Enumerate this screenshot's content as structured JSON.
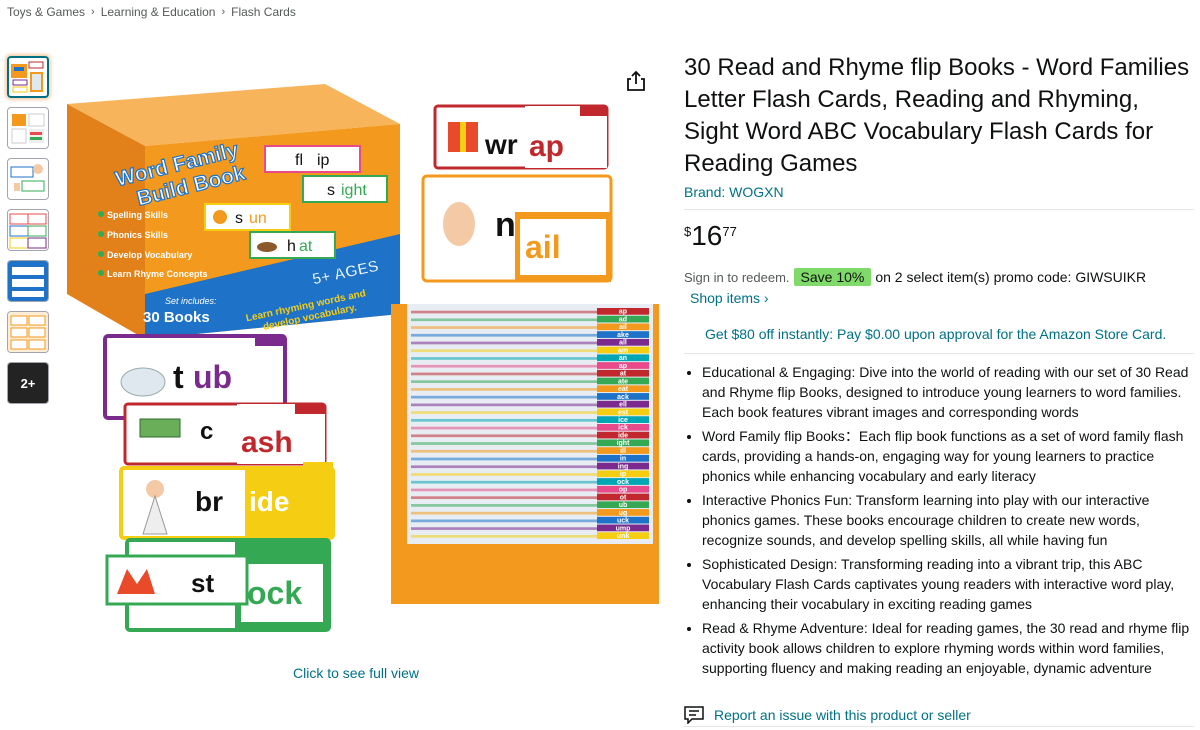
{
  "breadcrumb": [
    "Toys & Games",
    "Learning & Education",
    "Flash Cards"
  ],
  "thumbnails": {
    "more_label": "2+"
  },
  "main_image": {
    "box_title_line1": "Word Family",
    "box_title_line2": "Build Book",
    "box_features": [
      "Spelling Skills",
      "Phonics Skills",
      "Develop Vocabulary",
      "Learn Rhyme Concepts"
    ],
    "box_set_label": "Set includes:",
    "box_set_value": "30 Books",
    "box_ages": "5+ AGES",
    "box_slogan_line1": "Learn rhyming words and",
    "box_slogan_line2": "develop vocabulary.",
    "box_cards": [
      {
        "start": "fl",
        "end": "ip"
      },
      {
        "start": "s",
        "end": "ight"
      },
      {
        "start": "s",
        "end": "un"
      },
      {
        "start": "h",
        "end": "at"
      }
    ],
    "flip_cards": [
      {
        "start": "wr",
        "end": "ap"
      },
      {
        "start": "n",
        "end": "ail"
      },
      {
        "start": "t",
        "end": "ub"
      },
      {
        "start": "c",
        "end": "ash"
      },
      {
        "start": "br",
        "end": "ide"
      },
      {
        "start": "st",
        "end": "ock"
      }
    ],
    "tray_tabs": [
      "ap",
      "ad",
      "ail",
      "ake",
      "all",
      "am",
      "an",
      "ap",
      "at",
      "ate",
      "eat",
      "ack",
      "ell",
      "est",
      "ice",
      "ick",
      "ide",
      "ight",
      "ill",
      "in",
      "ing",
      "ip",
      "ock",
      "op",
      "ot",
      "ub",
      "ug",
      "uck",
      "ump",
      "unk"
    ],
    "click_full_view": "Click to see full view"
  },
  "product": {
    "title": "30 Read and Rhyme flip Books - Word Families Letter Flash Cards, Reading and Rhyming, Sight Word ABC Vocabulary Flash Cards for Reading Games",
    "brand": "Brand: WOGXN",
    "price": {
      "symbol": "$",
      "whole": "16",
      "fraction": "77"
    },
    "promo": {
      "signin": "Sign in to redeem.",
      "badge": "Save 10%",
      "text": "on 2 select item(s) promo code: GIWSUIKR",
      "shop_items": "Shop items ›"
    },
    "credit_offer": "Get $80 off instantly: Pay $0.00 upon approval for the Amazon Store Card.",
    "bullets": [
      "Educational & Engaging: Dive into the world of reading with our set of 30 Read and Rhyme flip Books, designed to introduce young learners to word families. Each book features vibrant images and corresponding words",
      "Word Family flip Books：Each flip book functions as a set of word family flash cards, providing a hands-on, engaging way for young learners to practice phonics while enhancing vocabulary and early literacy",
      "Interactive Phonics Fun: Transform learning into play with our interactive phonics games. These books encourage children to create new words, recognize sounds, and develop spelling skills, all while having fun",
      "Sophisticated Design: Transforming reading into a vibrant trip, this ABC Vocabulary Flash Cards captivates young readers with interactive word play, enhancing their vocabulary in exciting reading games",
      "Read & Rhyme Adventure: Ideal for reading games, the 30 read and rhyme flip activity book allows children to explore rhyming words within word families, supporting fluency and making reading an enjoyable, dynamic adventure"
    ],
    "report": "Report an issue with this product or seller"
  },
  "colors": {
    "link": "#007185",
    "badge": "#7FDA69",
    "box_orange": "#F39A1E",
    "box_blue": "#1E73C8"
  }
}
